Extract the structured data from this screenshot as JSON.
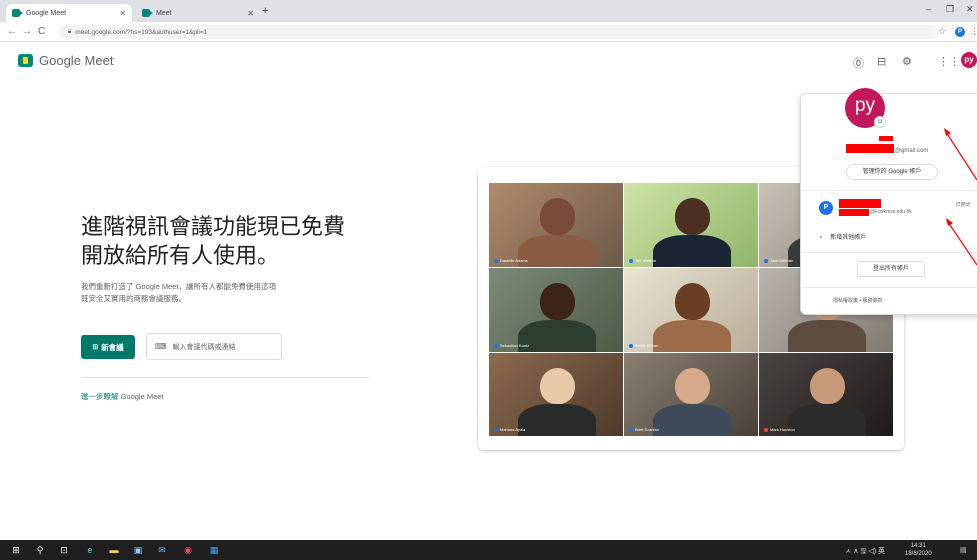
{
  "browser": {
    "tabs": [
      {
        "title": "Google Meet",
        "active": true
      },
      {
        "title": "Meet",
        "active": false
      }
    ],
    "new_tab": "+",
    "window_controls": {
      "minimize": "–",
      "restore": "❐",
      "close": "✕"
    },
    "nav": {
      "back": "←",
      "forward": "→",
      "reload": "C"
    },
    "url": "meet.google.com/?hs=193&authuser=1&pli=1",
    "profile_initial": "P"
  },
  "meet": {
    "logo_text": "Google Meet",
    "header_avatar": "py",
    "hero": {
      "title_lines": [
        "進階視訊會議功能現已免費",
        "開放給所有人使用。"
      ],
      "subtitle_lines": [
        "我們重新打造了 Google Meet，讓所有人都能免費使用這項",
        "既安全又實用的商務會議服務。"
      ]
    },
    "new_meeting_label": "新會議",
    "code_placeholder": "輸入會議代碼或連結",
    "learn_more": {
      "link": "進一步瞭解",
      "rest": " Google Meet"
    }
  },
  "video_tiles": [
    {
      "name": "Danielle Adams"
    },
    {
      "name": "Jeff Weston"
    },
    {
      "name": "Jack Sullivan"
    },
    {
      "name": "Sebastian Kuntz"
    },
    {
      "name": "Kelsie Brown"
    },
    {
      "name": ""
    },
    {
      "name": "Mariana Ayala"
    },
    {
      "name": "Brett Scanlan"
    },
    {
      "name": "Mark Houston"
    }
  ],
  "account_menu": {
    "avatar": "py",
    "primary_email_suffix": "@gmail.com",
    "manage_button": "管理你的 Google 帳戶",
    "secondary_initial": "P",
    "secondary_email_suffix": "@kcwkmss.edu.hk",
    "secondary_status": "已登出",
    "add_account": "新增其他帳戶",
    "sign_out_all": "登出所有帳戶",
    "footer": "隱私權政策 • 服務條款"
  },
  "taskbar": {
    "tray_text": "ㅅ ∧ 🖫 ◁) 英",
    "time": "14:31",
    "date": "18/8/2020"
  },
  "colors": {
    "meet_green": "#00796b",
    "avatar_pink": "#c2185b",
    "annotation_red": "#ff0000"
  }
}
